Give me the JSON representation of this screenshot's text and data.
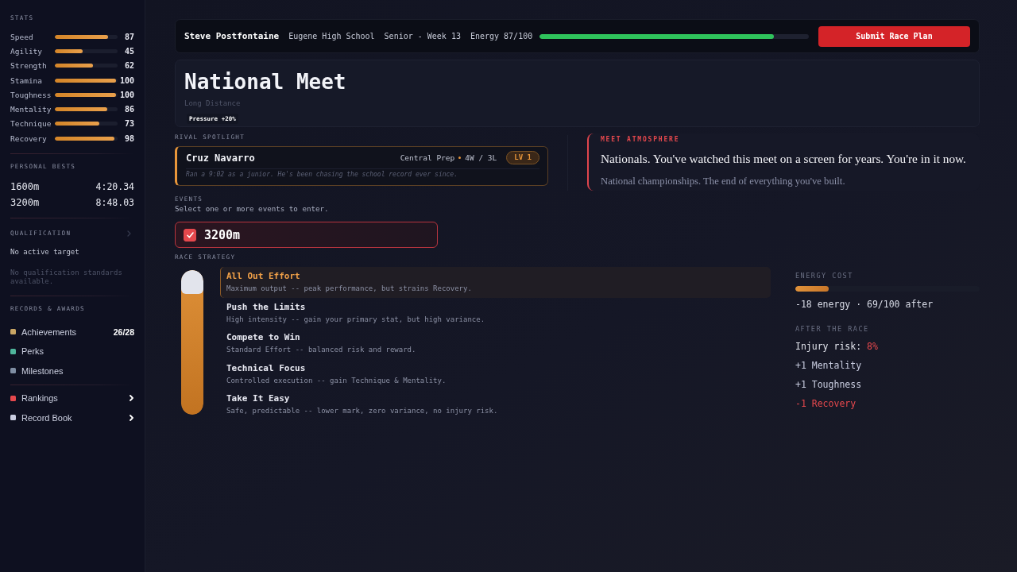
{
  "sidebar": {
    "stats": {
      "title": "STATS",
      "items": [
        {
          "name": "Speed",
          "value": "87",
          "level": 0.87
        },
        {
          "name": "Agility",
          "value": "45",
          "level": 0.45
        },
        {
          "name": "Strength",
          "value": "62",
          "level": 0.62
        },
        {
          "name": "Stamina",
          "value": "100",
          "level": 1.0
        },
        {
          "name": "Toughness",
          "value": "100",
          "level": 1.0
        },
        {
          "name": "Mentality",
          "value": "86",
          "level": 0.86
        },
        {
          "name": "Technique",
          "value": "73",
          "level": 0.73
        },
        {
          "name": "Recovery",
          "value": "98",
          "level": 0.98
        }
      ]
    },
    "personal_bests": {
      "title": "PERSONAL BESTS",
      "items": [
        {
          "event": "1600m",
          "time": "4:20.34"
        },
        {
          "event": "3200m",
          "time": "8:48.03"
        }
      ]
    },
    "qualification": {
      "title": "QUALIFICATION",
      "target": "No active target",
      "note": "No qualification standards available."
    },
    "records_awards": {
      "title": "RECORDS & AWARDS",
      "items": [
        {
          "label": "Achievements",
          "color": "#c8a564",
          "count": "26/28"
        },
        {
          "label": "Perks",
          "color": "#4fb59b"
        },
        {
          "label": "Milestones",
          "color": "#7f8ea3"
        }
      ],
      "links": [
        {
          "label": "Rankings",
          "color": "#e5484d"
        },
        {
          "label": "Record Book",
          "color": "#c9cde0"
        }
      ]
    }
  },
  "top_bar": {
    "player": "Steve Postfontaine",
    "school": "Eugene High School",
    "class_week": "Senior - Week 13",
    "energy": {
      "label": "Energy 87/100",
      "level": 0.87
    },
    "submit_button": "Submit Race Plan"
  },
  "meet": {
    "title": "National Meet",
    "distance": "Long Distance",
    "modifier": "Pressure +20%"
  },
  "rival_spotlight": {
    "title": "RIVAL SPOTLIGHT",
    "name": "Cruz Navarro",
    "school": "Central Prep",
    "record": "4W / 3L",
    "level_badge": "LV 1",
    "note": "Ran a 9:02 as a junior. He's been chasing the school record ever since."
  },
  "meet_atmosphere": {
    "title": "MEET ATMOSPHERE",
    "headline": "Nationals. You've watched this meet on a screen for years. You're in it now.",
    "detail": "National championships. The end of everything you've built."
  },
  "events": {
    "title": "EVENTS",
    "hint": "Select one or more events to enter.",
    "items": [
      {
        "label": "3200m",
        "checked": true
      }
    ]
  },
  "race_strategy": {
    "title": "RACE STRATEGY",
    "slider": {
      "level": 1.0
    },
    "options": [
      {
        "title": "All Out Effort",
        "description": "Maximum output -- peak performance, but strains Recovery.",
        "selected": true
      },
      {
        "title": "Push the Limits",
        "description": "High intensity -- gain your primary stat, but high variance.",
        "selected": false
      },
      {
        "title": "Compete to Win",
        "description": "Standard Effort -- balanced risk and reward.",
        "selected": false
      },
      {
        "title": "Technical Focus",
        "description": "Controlled execution -- gain Technique & Mentality.",
        "selected": false
      },
      {
        "title": "Take It Easy",
        "description": "Safe, predictable -- lower mark, zero variance, no injury risk.",
        "selected": false
      }
    ]
  },
  "summary": {
    "energy_cost": {
      "title": "ENERGY COST",
      "level": 0.18,
      "text": "-18 energy · 69/100 after"
    },
    "after_race": {
      "title": "AFTER THE RACE",
      "injury_risk": {
        "label": "Injury risk:",
        "value": "8%"
      },
      "effects": [
        {
          "text": "+1 Mentality",
          "kind": "gain"
        },
        {
          "text": "+1 Toughness",
          "kind": "gain"
        },
        {
          "text": "-1 Recovery",
          "kind": "loss"
        }
      ]
    }
  }
}
